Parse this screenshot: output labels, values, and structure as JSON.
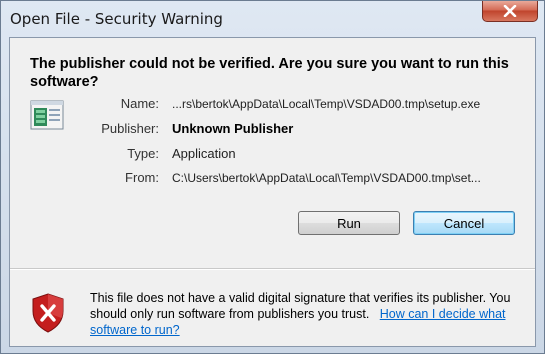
{
  "window": {
    "title": "Open File - Security Warning"
  },
  "dialog": {
    "heading": "The publisher could not be verified.  Are you sure you want to run this software?",
    "fields": {
      "name_label": "Name:",
      "name_value": "...rs\\bertok\\AppData\\Local\\Temp\\VSDAD00.tmp\\setup.exe",
      "publisher_label": "Publisher:",
      "publisher_value": "Unknown Publisher",
      "type_label": "Type:",
      "type_value": "Application",
      "from_label": "From:",
      "from_value": "C:\\Users\\bertok\\AppData\\Local\\Temp\\VSDAD00.tmp\\set..."
    },
    "buttons": {
      "run": "Run",
      "cancel": "Cancel"
    },
    "warning": {
      "text": "This file does not have a valid digital signature that verifies its publisher.  You should only run software from publishers you trust.",
      "link": "How can I decide what software to run?"
    }
  },
  "colors": {
    "link": "#0066cc",
    "close_button": "#c0442c",
    "shield_red": "#c41e1e"
  },
  "icons": {
    "close": "close-icon",
    "app": "application-icon",
    "shield": "security-shield-icon"
  }
}
